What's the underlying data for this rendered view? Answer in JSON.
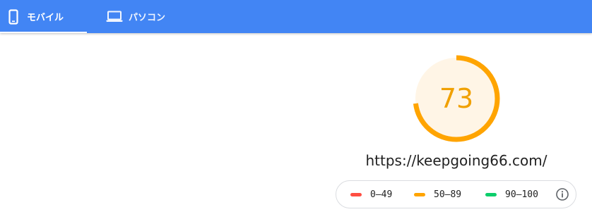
{
  "tabs": [
    {
      "label": "モバイル",
      "icon": "smartphone-icon",
      "selected": true
    },
    {
      "label": "パソコン",
      "icon": "laptop-icon",
      "selected": false
    }
  ],
  "report": {
    "score": 73,
    "score_fraction": 0.73,
    "url": "https://keepgoing66.com/"
  },
  "legend": {
    "items": [
      {
        "label": "0–49",
        "color": "#ff4e42"
      },
      {
        "label": "50–89",
        "color": "#ffa400"
      },
      {
        "label": "90–100",
        "color": "#0cce6b"
      }
    ],
    "info_icon": "info-icon"
  },
  "colors": {
    "header": "#4285f4",
    "score_average": "#ffa400",
    "score_average_text": "#f0a000",
    "gauge_fill": "#fff5e6"
  }
}
